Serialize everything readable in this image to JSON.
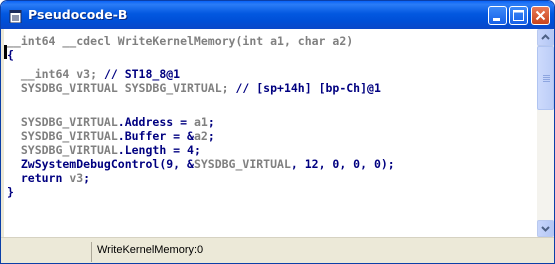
{
  "window": {
    "title": "Pseudocode-B",
    "icon": "document-icon",
    "controls": [
      "minimize-icon",
      "maximize-icon",
      "close-icon"
    ]
  },
  "colors": {
    "keyword": "#000080",
    "comment": "#000080",
    "variable": "#808080",
    "identifier": "#0000ff",
    "plain": "#000080",
    "titlebar": "#0058e6"
  },
  "code": {
    "lines": [
      [
        {
          "t": "__int64 __cdecl WriteKernelMemory(int a1, char a2)",
          "c": "variable"
        }
      ],
      [
        {
          "t": "{",
          "c": "plain"
        }
      ],
      [
        {
          "t": "  __int64 v3; ",
          "c": "variable"
        },
        {
          "t": "// ST18_8@1",
          "c": "comment"
        }
      ],
      [
        {
          "t": "  SYSDBG_VIRTUAL SYSDBG_VIRTUAL; ",
          "c": "variable"
        },
        {
          "t": "// [sp+14h] [bp-Ch]@1",
          "c": "comment"
        }
      ],
      [
        {
          "t": "",
          "c": "plain"
        }
      ],
      [
        {
          "t": "  SYSDBG_VIRTUAL",
          "c": "variable"
        },
        {
          "t": ".Address = ",
          "c": "plain"
        },
        {
          "t": "a1",
          "c": "variable"
        },
        {
          "t": ";",
          "c": "plain"
        }
      ],
      [
        {
          "t": "  SYSDBG_VIRTUAL",
          "c": "variable"
        },
        {
          "t": ".Buffer = &",
          "c": "plain"
        },
        {
          "t": "a2",
          "c": "variable"
        },
        {
          "t": ";",
          "c": "plain"
        }
      ],
      [
        {
          "t": "  SYSDBG_VIRTUAL",
          "c": "variable"
        },
        {
          "t": ".Length = 4;",
          "c": "plain"
        }
      ],
      [
        {
          "t": "  ZwSystemDebugControl(9, &",
          "c": "plain"
        },
        {
          "t": "SYSDBG_VIRTUAL",
          "c": "variable"
        },
        {
          "t": ", 12, 0, 0, 0);",
          "c": "plain"
        }
      ],
      [
        {
          "t": "  return ",
          "c": "plain"
        },
        {
          "t": "v3",
          "c": "variable"
        },
        {
          "t": ";",
          "c": "plain"
        }
      ],
      [
        {
          "t": "}",
          "c": "plain"
        }
      ]
    ]
  },
  "status": {
    "text": "WriteKernelMemory:0"
  }
}
